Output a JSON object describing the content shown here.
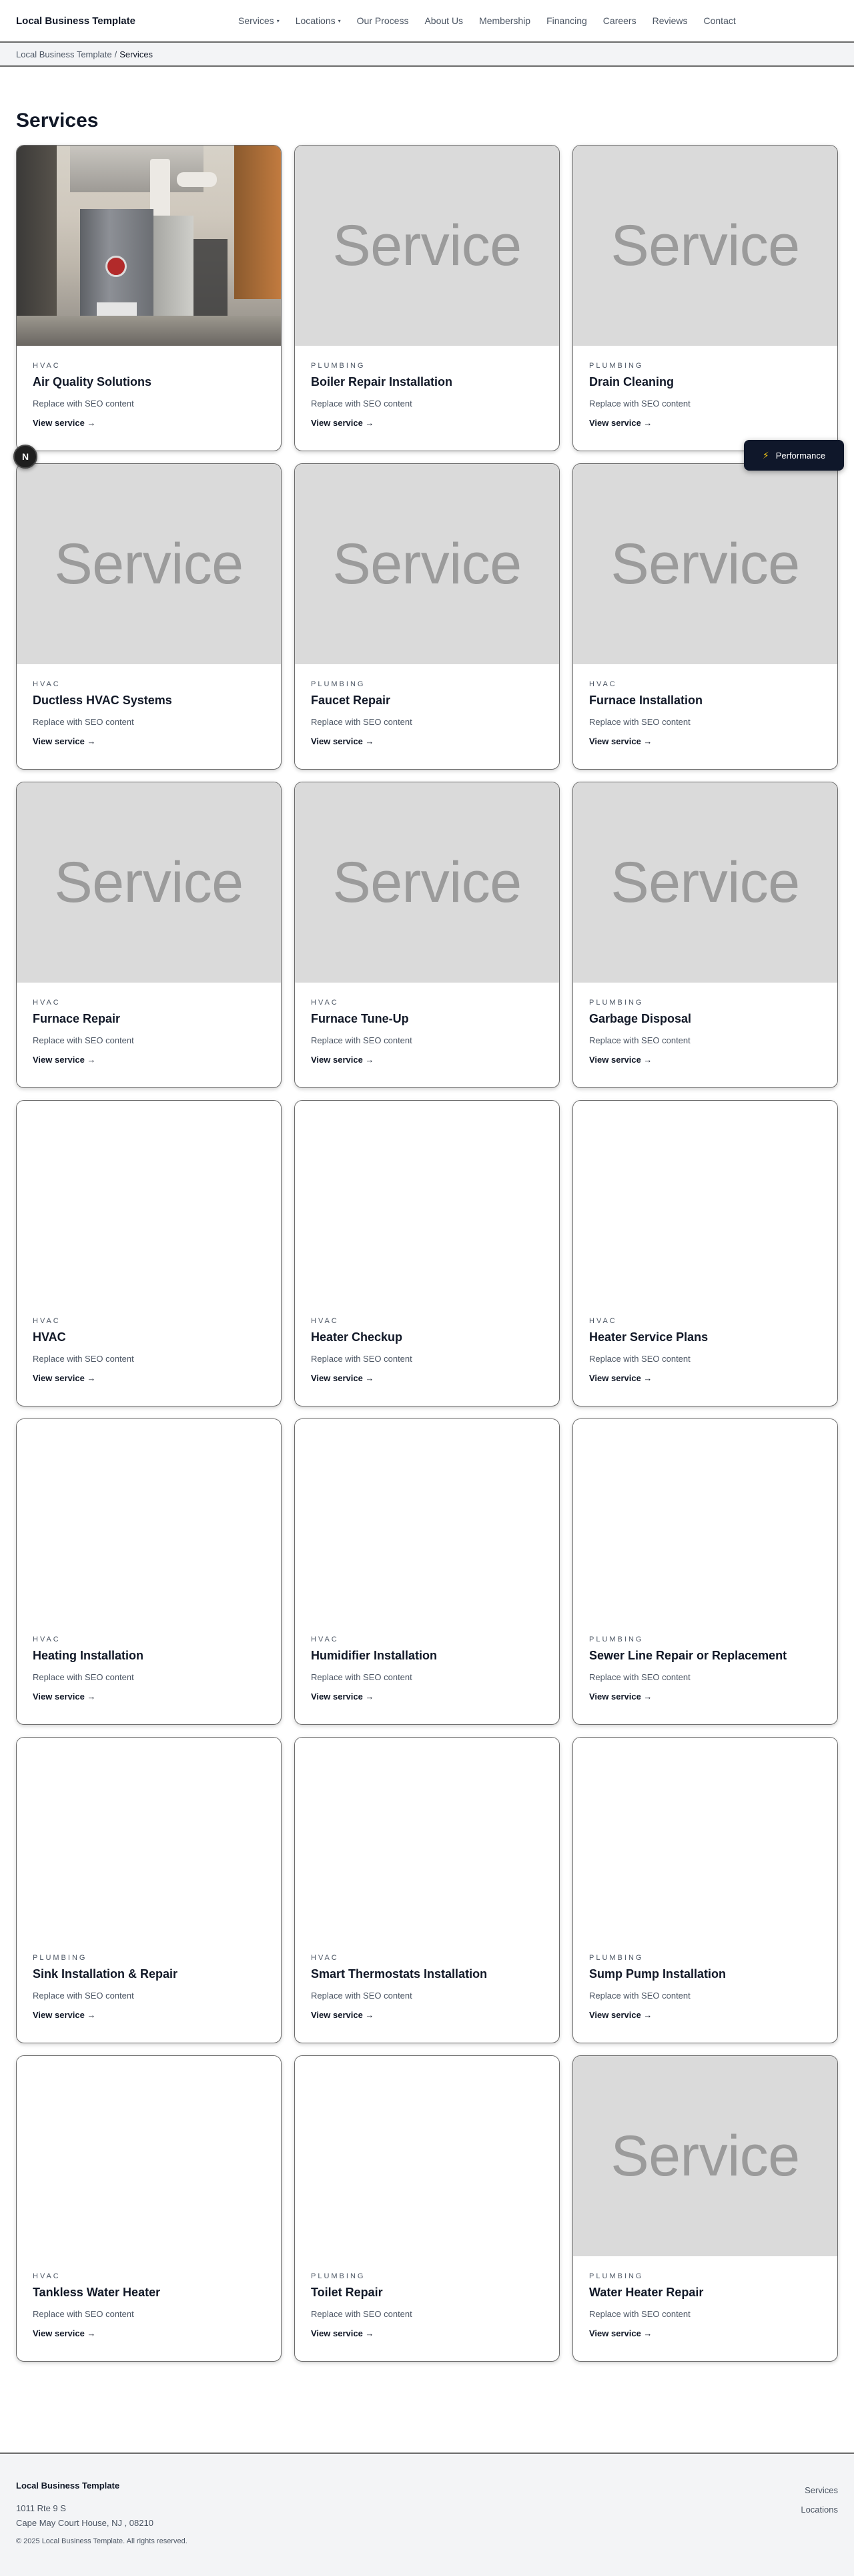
{
  "header": {
    "brand": "Local Business Template",
    "nav": [
      {
        "label": "Services",
        "has_dropdown": true
      },
      {
        "label": "Locations",
        "has_dropdown": true
      },
      {
        "label": "Our Process",
        "has_dropdown": false
      },
      {
        "label": "About Us",
        "has_dropdown": false
      },
      {
        "label": "Membership",
        "has_dropdown": false
      },
      {
        "label": "Financing",
        "has_dropdown": false
      },
      {
        "label": "Careers",
        "has_dropdown": false
      },
      {
        "label": "Reviews",
        "has_dropdown": false
      },
      {
        "label": "Contact",
        "has_dropdown": false
      }
    ]
  },
  "breadcrumb": {
    "home": "Local Business Template",
    "separator": "/",
    "current": "Services"
  },
  "page": {
    "title": "Services"
  },
  "placeholder_label": "Service",
  "link_label": "View service →",
  "services": [
    {
      "category": "HVAC",
      "title": "Air Quality Solutions",
      "desc": "Replace with SEO content",
      "media": "photo"
    },
    {
      "category": "PLUMBING",
      "title": "Boiler Repair Installation",
      "desc": "Replace with SEO content",
      "media": "placeholder"
    },
    {
      "category": "PLUMBING",
      "title": "Drain Cleaning",
      "desc": "Replace with SEO content",
      "media": "placeholder"
    },
    {
      "category": "HVAC",
      "title": "Ductless HVAC Systems",
      "desc": "Replace with SEO content",
      "media": "placeholder"
    },
    {
      "category": "PLUMBING",
      "title": "Faucet Repair",
      "desc": "Replace with SEO content",
      "media": "placeholder"
    },
    {
      "category": "HVAC",
      "title": "Furnace Installation",
      "desc": "Replace with SEO content",
      "media": "placeholder"
    },
    {
      "category": "HVAC",
      "title": "Furnace Repair",
      "desc": "Replace with SEO content",
      "media": "placeholder"
    },
    {
      "category": "HVAC",
      "title": "Furnace Tune-Up",
      "desc": "Replace with SEO content",
      "media": "placeholder"
    },
    {
      "category": "PLUMBING",
      "title": "Garbage Disposal",
      "desc": "Replace with SEO content",
      "media": "placeholder"
    },
    {
      "category": "HVAC",
      "title": "HVAC",
      "desc": "Replace with SEO content",
      "media": "blank"
    },
    {
      "category": "HVAC",
      "title": "Heater Checkup",
      "desc": "Replace with SEO content",
      "media": "blank"
    },
    {
      "category": "HVAC",
      "title": "Heater Service Plans",
      "desc": "Replace with SEO content",
      "media": "blank"
    },
    {
      "category": "HVAC",
      "title": "Heating Installation",
      "desc": "Replace with SEO content",
      "media": "blank"
    },
    {
      "category": "HVAC",
      "title": "Humidifier Installation",
      "desc": "Replace with SEO content",
      "media": "blank"
    },
    {
      "category": "PLUMBING",
      "title": "Sewer Line Repair or Replacement",
      "desc": "Replace with SEO content",
      "media": "blank"
    },
    {
      "category": "PLUMBING",
      "title": "Sink Installation & Repair",
      "desc": "Replace with SEO content",
      "media": "blank"
    },
    {
      "category": "HVAC",
      "title": "Smart Thermostats Installation",
      "desc": "Replace with SEO content",
      "media": "blank"
    },
    {
      "category": "PLUMBING",
      "title": "Sump Pump Installation",
      "desc": "Replace with SEO content",
      "media": "blank"
    },
    {
      "category": "HVAC",
      "title": "Tankless Water Heater",
      "desc": "Replace with SEO content",
      "media": "blank"
    },
    {
      "category": "PLUMBING",
      "title": "Toilet Repair",
      "desc": "Replace with SEO content",
      "media": "blank"
    },
    {
      "category": "PLUMBING",
      "title": "Water Heater Repair",
      "desc": "Replace with SEO content",
      "media": "placeholder"
    }
  ],
  "floating": {
    "n_badge": "N",
    "performance_label": "Performance",
    "performance_icon": "bolt-icon"
  },
  "footer": {
    "brand": "Local Business Template",
    "address_line1": "1011 Rte 9 S",
    "address_line2": "Cape May Court House, NJ , 08210",
    "copyright": "© 2025 Local Business Template. All rights reserved.",
    "links": [
      "Services",
      "Locations"
    ]
  }
}
